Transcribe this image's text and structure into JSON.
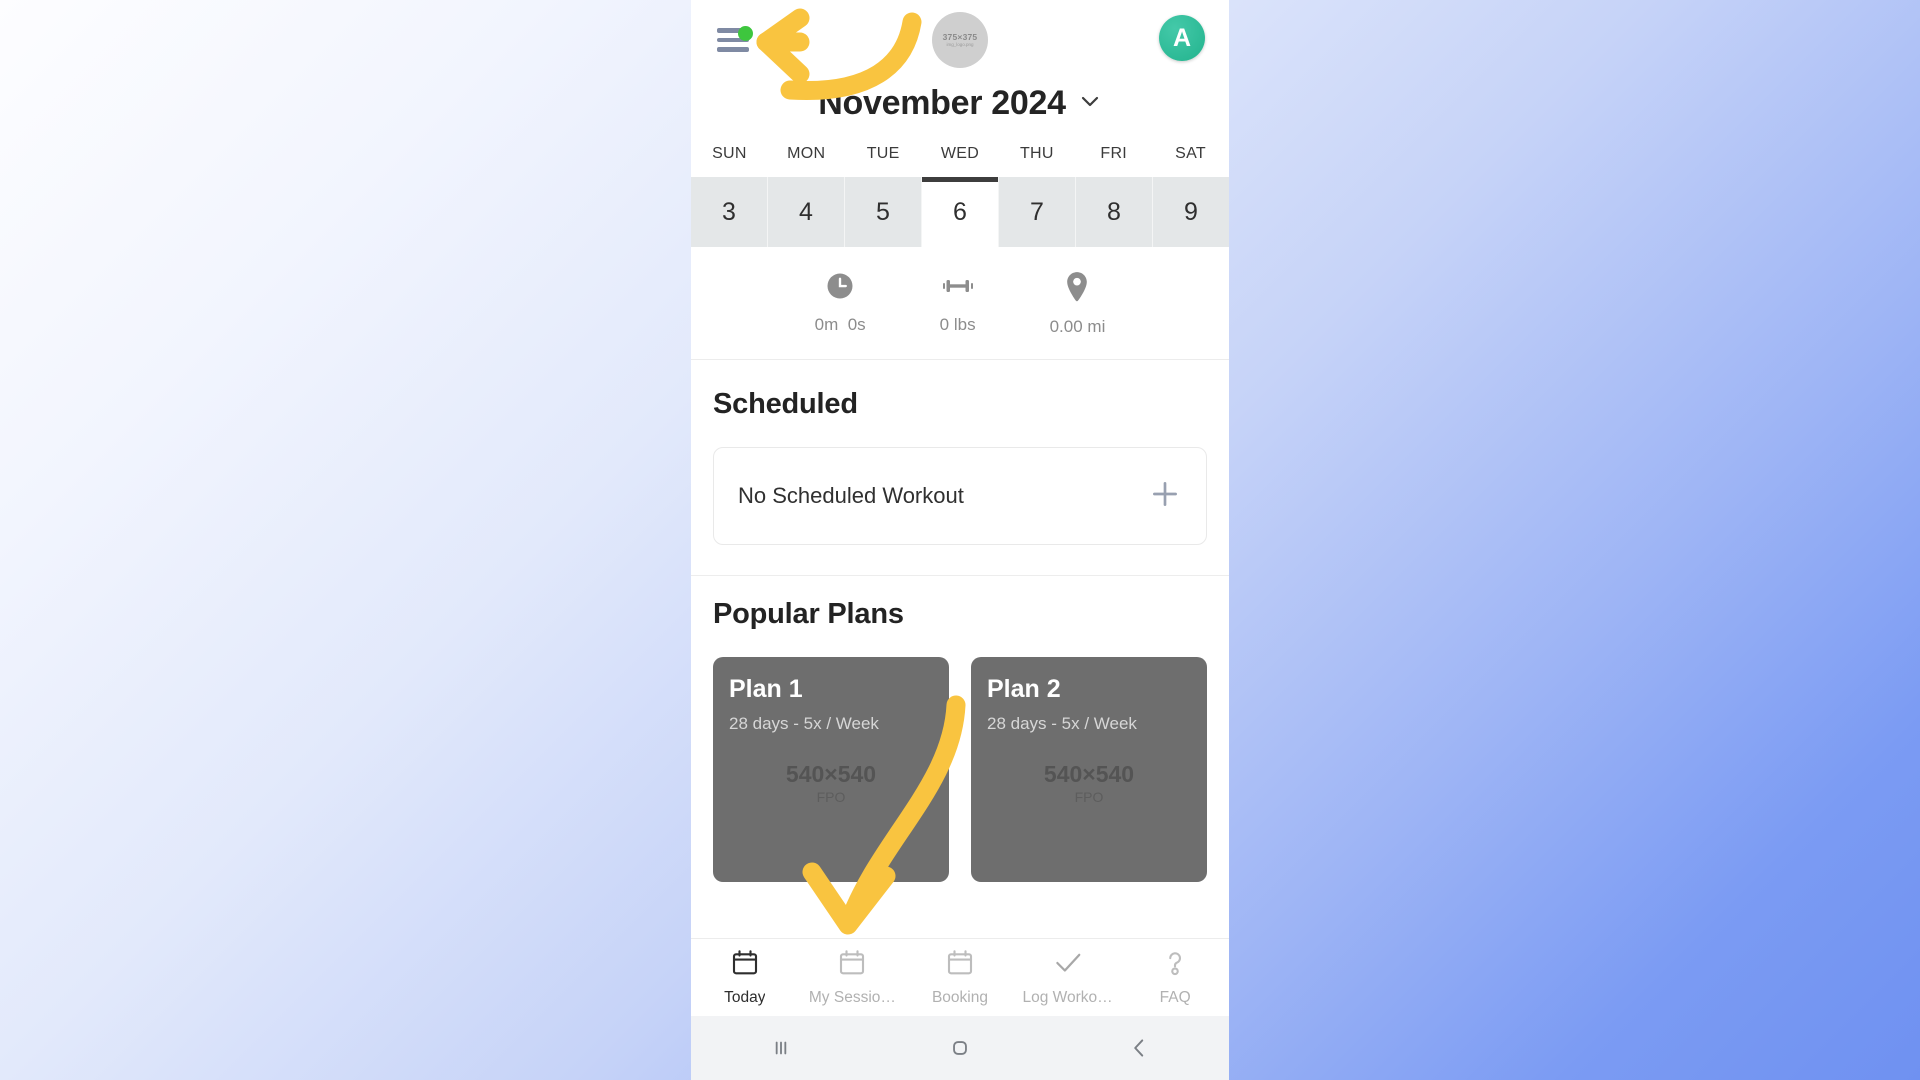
{
  "app": {
    "accent_green": "#3ec63e",
    "avatar_color": "#22b38d",
    "annotation_color": "#F9C440",
    "card_color": "#6e6e6e"
  },
  "topbar": {
    "menu_icon": "hamburger-menu-icon",
    "menu_badge": "green-dot-badge",
    "logo_placeholder_size": "375×375",
    "logo_placeholder_sub": "img_logo.png",
    "avatar_initial": "A"
  },
  "calendar": {
    "month_label": "November 2024",
    "chevron": "chevron-down-icon",
    "weekdays": [
      "SUN",
      "MON",
      "TUE",
      "WED",
      "THU",
      "FRI",
      "SAT"
    ],
    "dates": [
      "3",
      "4",
      "5",
      "6",
      "7",
      "8",
      "9"
    ],
    "selected_index": 3,
    "selected_date": "6",
    "selected_weekday": "WED"
  },
  "stats": [
    {
      "icon": "clock-icon",
      "value": "0m  0s"
    },
    {
      "icon": "dumbbell-icon",
      "value": "0 lbs"
    },
    {
      "icon": "location-pin-icon",
      "value": "0.00 mi"
    }
  ],
  "scheduled": {
    "heading": "Scheduled",
    "empty_text": "No Scheduled Workout",
    "add_icon": "plus-icon"
  },
  "popular_plans": {
    "heading": "Popular Plans",
    "cards": [
      {
        "title": "Plan 1",
        "subtitle": "28 days - 5x / Week",
        "placeholder_size": "540×540",
        "placeholder_sub": "FPO"
      },
      {
        "title": "Plan 2",
        "subtitle": "28 days - 5x / Week",
        "placeholder_size": "540×540",
        "placeholder_sub": "FPO"
      }
    ]
  },
  "tabs": [
    {
      "icon": "calendar-today-icon",
      "label": "Today",
      "active": true
    },
    {
      "icon": "calendar-icon",
      "label": "My Sessio…",
      "active": false
    },
    {
      "icon": "calendar-icon",
      "label": "Booking",
      "active": false
    },
    {
      "icon": "check-icon",
      "label": "Log Worko…",
      "active": false
    },
    {
      "icon": "question-mark-icon",
      "label": "FAQ",
      "active": false
    }
  ],
  "system_nav": [
    {
      "icon": "recents-icon"
    },
    {
      "icon": "home-icon"
    },
    {
      "icon": "back-icon"
    }
  ]
}
